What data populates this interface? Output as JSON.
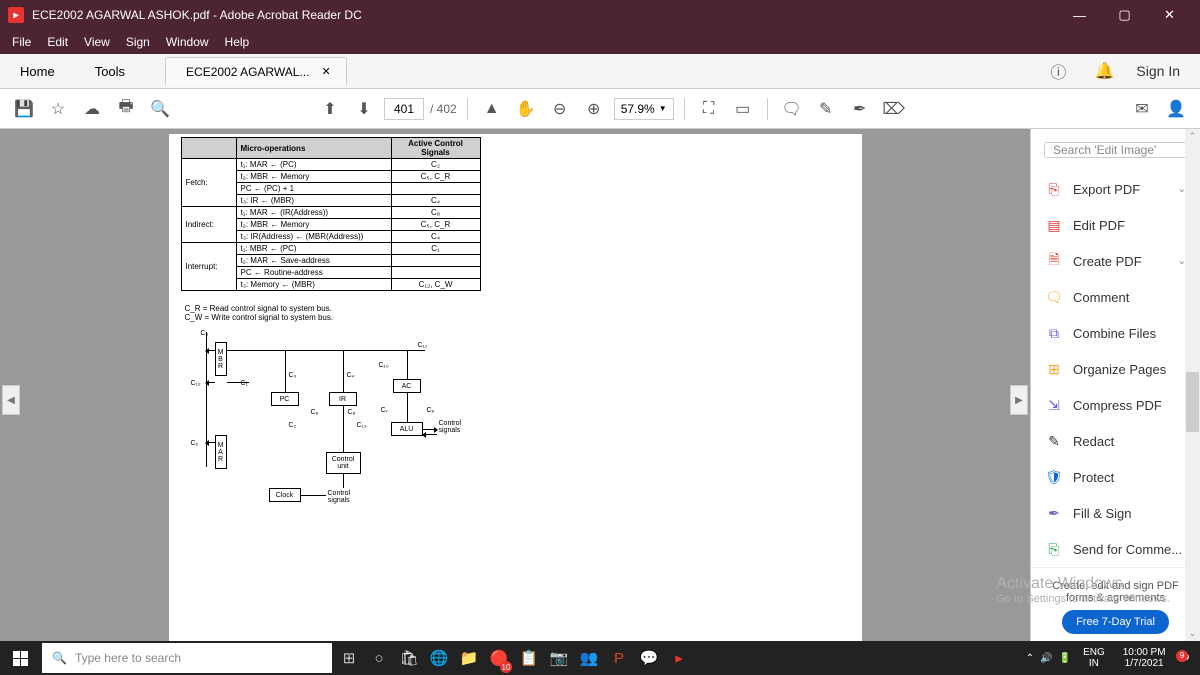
{
  "titlebar": {
    "title": "ECE2002 AGARWAL ASHOK.pdf - Adobe Acrobat Reader DC"
  },
  "menubar": {
    "items": [
      "File",
      "Edit",
      "View",
      "Sign",
      "Window",
      "Help"
    ]
  },
  "tabs": {
    "home": "Home",
    "tools": "Tools",
    "doc": "ECE2002 AGARWAL...",
    "signin": "Sign In"
  },
  "toolbar": {
    "page": "401",
    "total": "/ 402",
    "zoom": "57.9%"
  },
  "right": {
    "search_placeholder": "Search 'Edit Image'",
    "items": [
      {
        "label": "Export PDF",
        "color": "#e8342f",
        "chev": true,
        "icon": "⎘"
      },
      {
        "label": "Edit PDF",
        "color": "#e8342f",
        "icon": "▤"
      },
      {
        "label": "Create PDF",
        "color": "#e8342f",
        "chev": true,
        "icon": "🗎"
      },
      {
        "label": "Comment",
        "color": "#f5a623",
        "icon": "🗨"
      },
      {
        "label": "Combine Files",
        "color": "#6b5bd2",
        "icon": "⧉"
      },
      {
        "label": "Organize Pages",
        "color": "#f5a623",
        "icon": "⊞"
      },
      {
        "label": "Compress PDF",
        "color": "#6b5bd2",
        "icon": "⇲"
      },
      {
        "label": "Redact",
        "color": "#333",
        "icon": "✎"
      },
      {
        "label": "Protect",
        "color": "#0d66d0",
        "icon": "🛡"
      },
      {
        "label": "Fill & Sign",
        "color": "#7b5bbe",
        "icon": "✒"
      },
      {
        "label": "Send for Comme...",
        "color": "#2aa24a",
        "icon": "⎘"
      }
    ],
    "promo": "Create, edit and sign PDF forms & agreements",
    "trial": "Free 7-Day Trial"
  },
  "watermark": {
    "l1": "Activate Windows",
    "l2": "Go to Settings to activate Windows."
  },
  "taskbar": {
    "search": "Type here to search",
    "lang1": "ENG",
    "lang2": "IN",
    "time": "10:00 PM",
    "date": "1/7/2021",
    "notif": "9",
    "chrome": "10"
  },
  "figure": {
    "headers": [
      "",
      "Micro-operations",
      "Active Control Signals"
    ],
    "rows": [
      {
        "phase": "Fetch:",
        "ops": [
          {
            "t": "t₁: MAR ← (PC)",
            "sig": "C₂"
          },
          {
            "t": "t₂: MBR ← Memory",
            "sig": "C₅, C_R"
          },
          {
            "t": "    PC ← (PC) + 1",
            "sig": ""
          },
          {
            "t": "t₃: IR ← (MBR)",
            "sig": "C₄"
          }
        ]
      },
      {
        "phase": "Indirect:",
        "ops": [
          {
            "t": "t₁: MAR ← (IR(Address))",
            "sig": "C₈"
          },
          {
            "t": "t₂: MBR ← Memory",
            "sig": "C₅, C_R"
          },
          {
            "t": "t₃: IR(Address) ← (MBR(Address))",
            "sig": "C₄"
          }
        ]
      },
      {
        "phase": "Interrupt:",
        "ops": [
          {
            "t": "t₁: MBR ← (PC)",
            "sig": "C₁"
          },
          {
            "t": "t₂: MAR ← Save-address",
            "sig": ""
          },
          {
            "t": "    PC ← Routine-address",
            "sig": ""
          },
          {
            "t": "t₃: Memory ← (MBR)",
            "sig": "C₁₂, C_W"
          }
        ]
      }
    ],
    "note1": "C_R = Read control signal to system bus.",
    "note2": "C_W = Write control signal to system bus.",
    "blocks": {
      "mbr": "M\nB\nR",
      "mar": "M\nA\nR",
      "pc": "PC",
      "ir": "IR",
      "ac": "AC",
      "alu": "ALU",
      "cu": "Control\nunit",
      "clk": "Clock",
      "cs": "Control\nsignals",
      "csr": "Control\nsignals"
    },
    "sig": {
      "c0": "C₀",
      "c1": "C₁",
      "c2": "C₂",
      "c3": "C₃",
      "c4": "C₄",
      "c5": "C₅",
      "c6": "C₆",
      "c7": "C₇",
      "c8": "C₈",
      "c9": "C₉",
      "c10": "C₁₀",
      "c11": "C₁₁",
      "c12": "C₁₂",
      "c13": "C₁₃"
    }
  }
}
